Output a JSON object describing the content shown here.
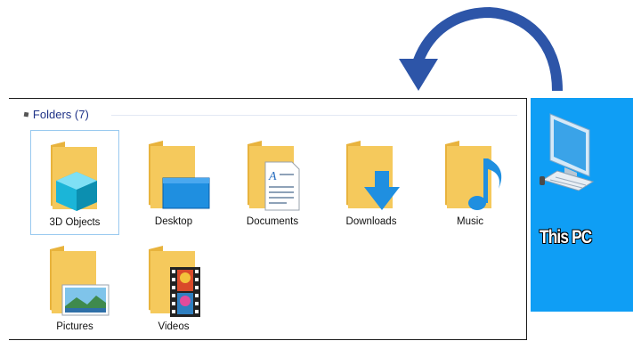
{
  "group": {
    "title": "Folders (7)"
  },
  "folders": [
    {
      "label": "3D Objects",
      "icon": "3d-objects-icon"
    },
    {
      "label": "Desktop",
      "icon": "desktop-icon"
    },
    {
      "label": "Documents",
      "icon": "documents-icon"
    },
    {
      "label": "Downloads",
      "icon": "downloads-icon"
    },
    {
      "label": "Music",
      "icon": "music-icon"
    },
    {
      "label": "Pictures",
      "icon": "pictures-icon"
    },
    {
      "label": "Videos",
      "icon": "videos-icon"
    }
  ],
  "desktop_shortcut": {
    "label": "This PC",
    "icon": "computer-icon"
  },
  "colors": {
    "folder": "#f5c95c",
    "folder_back": "#e8b33d",
    "selection_border": "#99c9ef",
    "desktop_blue": "#0f9ef5",
    "arrow": "#2d55a8"
  }
}
